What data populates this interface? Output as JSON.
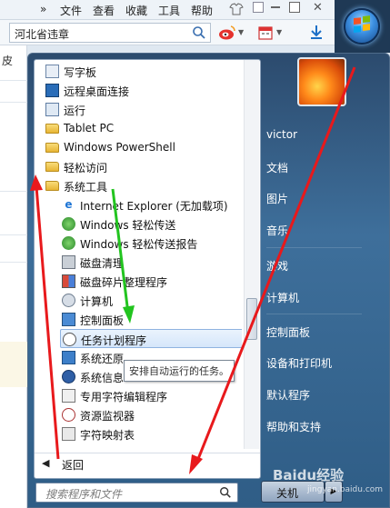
{
  "browser": {
    "menu": [
      {
        "label": "»"
      },
      {
        "label": "文件"
      },
      {
        "label": "查看"
      },
      {
        "label": "收藏"
      },
      {
        "label": "工具"
      },
      {
        "label": "帮助"
      }
    ],
    "address": "河北省违章",
    "side_char": "皮"
  },
  "start_menu": {
    "programs": [
      {
        "label": "写字板",
        "icon": "wordpad-icon"
      },
      {
        "label": "远程桌面连接",
        "icon": "remote-desktop-icon"
      },
      {
        "label": "运行",
        "icon": "run-icon"
      },
      {
        "label": "Tablet PC",
        "icon": "folder-icon"
      },
      {
        "label": "Windows PowerShell",
        "icon": "folder-icon"
      },
      {
        "label": "轻松访问",
        "icon": "folder-icon"
      },
      {
        "label": "系统工具",
        "icon": "folder-icon"
      },
      {
        "label": "Internet Explorer (无加载项)",
        "icon": "ie-icon"
      },
      {
        "label": "Windows 轻松传送",
        "icon": "transfer-icon"
      },
      {
        "label": "Windows 轻松传送报告",
        "icon": "transfer-report-icon"
      },
      {
        "label": "磁盘清理",
        "icon": "disk-cleanup-icon"
      },
      {
        "label": "磁盘碎片整理程序",
        "icon": "defrag-icon"
      },
      {
        "label": "计算机",
        "icon": "computer-icon"
      },
      {
        "label": "控制面板",
        "icon": "control-panel-icon"
      },
      {
        "label": "任务计划程序",
        "icon": "clock-icon"
      },
      {
        "label": "系统还原",
        "icon": "system-restore-icon"
      },
      {
        "label": "系统信息",
        "icon": "system-info-icon"
      },
      {
        "label": "专用字符编辑程序",
        "icon": "char-editor-icon"
      },
      {
        "label": "资源监视器",
        "icon": "resource-monitor-icon"
      },
      {
        "label": "字符映射表",
        "icon": "charmap-icon"
      }
    ],
    "selected": "任务计划程序",
    "tooltip": "安排自动运行的任务。",
    "back_label": "返回",
    "search_placeholder": "搜索程序和文件",
    "right_links": [
      {
        "label": "victor"
      },
      {
        "label": "文档"
      },
      {
        "label": "图片"
      },
      {
        "label": "音乐"
      },
      {
        "label": "游戏"
      },
      {
        "label": "计算机"
      },
      {
        "label": "控制面板"
      },
      {
        "label": "设备和打印机"
      },
      {
        "label": "默认程序"
      },
      {
        "label": "帮助和支持"
      }
    ],
    "shutdown_label": "关机"
  },
  "watermark": {
    "text": "Baidu经验",
    "sub": "jingyan.baidu.com"
  },
  "colors": {
    "arrow_red": "#e8191c",
    "arrow_green": "#22c41f",
    "menu_blue": "#2f5d86"
  }
}
